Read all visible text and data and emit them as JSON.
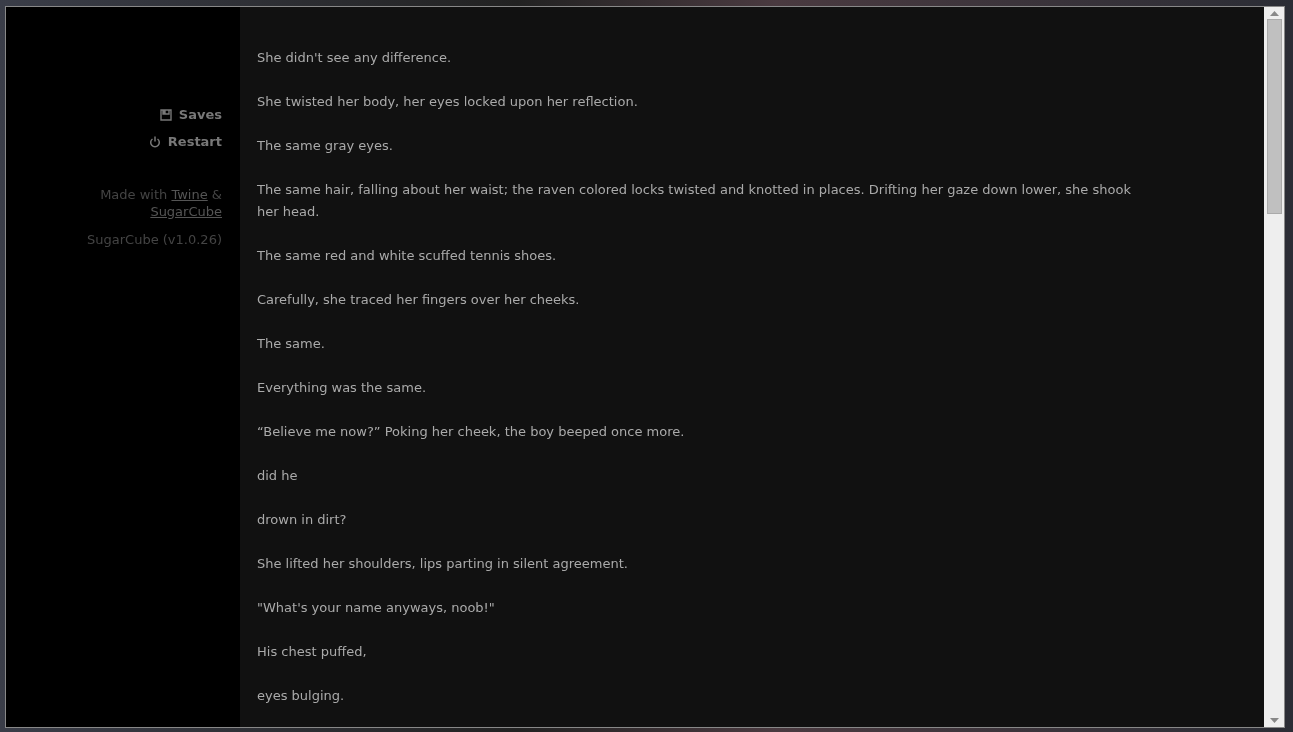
{
  "sidebar": {
    "menu": [
      {
        "kind": "saves",
        "label": "Saves"
      },
      {
        "kind": "restart",
        "label": "Restart"
      }
    ],
    "credits": [
      {
        "kind": "text",
        "text": "Made with"
      },
      {
        "kind": "link",
        "text": "Twine"
      },
      {
        "kind": "text",
        "text": "&"
      },
      {
        "kind": "link",
        "text": "SugarCube"
      }
    ],
    "version": "SugarCube (v1.0.26)"
  },
  "passage": [
    "She didn't see any difference.",
    "She twisted her body, her eyes locked upon her reflection.",
    "The same gray eyes.",
    "The same hair, falling about her waist; the raven colored locks twisted and knotted in places. Drifting her gaze down lower, she shook her head.",
    "The same red and white scuffed tennis shoes.",
    "Carefully, she traced her fingers over her cheeks.",
    "The same.",
    "Everything was the same.",
    "“Believe me now?” Poking her cheek, the boy beeped once more.",
    "did he",
    "drown in dirt?",
    "She lifted her shoulders, lips parting in silent agreement.",
    "\"What's your name anyways, noob!\"",
    "His chest puffed,",
    "eyes bulging."
  ]
}
